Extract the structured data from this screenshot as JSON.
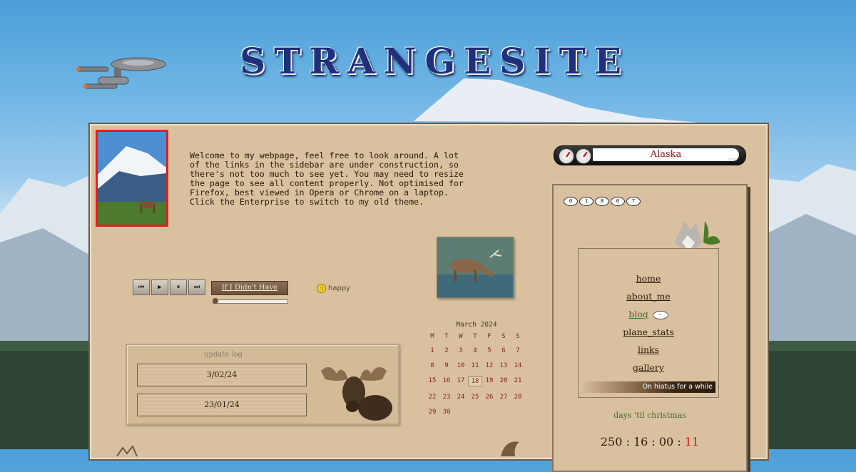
{
  "site": {
    "logo_text": "STRANGESITE"
  },
  "intro": {
    "welcome_text": "Welcome to my webpage, feel free to look around. A lot of the links in the sidebar are under construction, so there's not too much to see yet. You may need to resize the page to see all content properly. Not optimised for Firefox, best viewed in Opera or Chrome on a laptop. Click the Enterprise to switch to my old theme."
  },
  "player": {
    "controls": [
      {
        "name": "previous-button",
        "glyph": "⏮"
      },
      {
        "name": "play-button",
        "glyph": "▶"
      },
      {
        "name": "pause-button",
        "glyph": "⏸"
      },
      {
        "name": "next-button",
        "glyph": "⏭"
      }
    ],
    "track_title": "If I Didn't Have",
    "mood_label": "happy"
  },
  "update_log": {
    "title": "update log",
    "entries": [
      "3/02/24",
      "23/01/24"
    ]
  },
  "calendar": {
    "title": "March 2024",
    "weekdays": [
      "M",
      "T",
      "W",
      "T",
      "F",
      "S",
      "S"
    ],
    "days": [
      "1",
      "2",
      "3",
      "4",
      "5",
      "6",
      "7",
      "8",
      "9",
      "10",
      "11",
      "12",
      "13",
      "14",
      "15",
      "16",
      "17",
      "18",
      "19",
      "20",
      "21",
      "22",
      "23",
      "24",
      "25",
      "26",
      "27",
      "28",
      "29",
      "30",
      "",
      "",
      "",
      "",
      ""
    ],
    "today": "18"
  },
  "location_clock": {
    "label": "Alaska"
  },
  "visitor_counter": [
    "0",
    "1",
    "8",
    "0",
    "7"
  ],
  "nav": {
    "items": [
      {
        "label": "home",
        "active": false
      },
      {
        "label": "about_me",
        "active": false
      },
      {
        "label": "blog",
        "active": true
      },
      {
        "label": "plane_stats",
        "active": false
      },
      {
        "label": "links",
        "active": false
      },
      {
        "label": "gallery",
        "active": false
      }
    ],
    "status_text": "On hiatus for a while"
  },
  "christmas": {
    "title": "days 'til christmas",
    "days": "250",
    "hours": "16",
    "minutes": "00",
    "seconds": "11"
  },
  "colors": {
    "panel_bg": "#d9c19f",
    "accent_red": "#8b1a1a",
    "accent_green": "#3f6a2a"
  }
}
